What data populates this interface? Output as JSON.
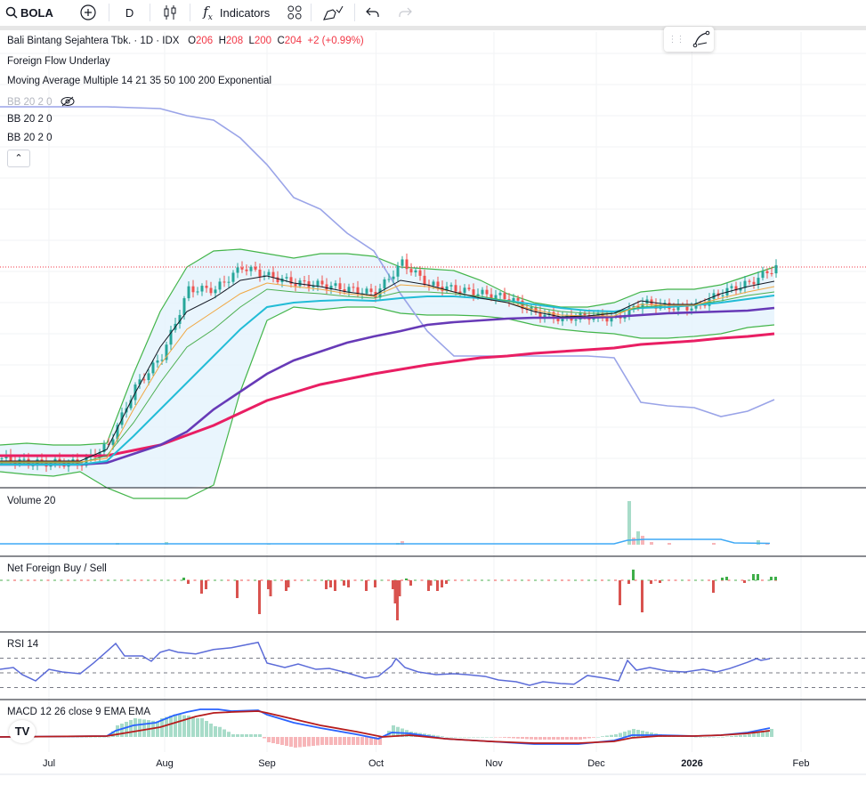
{
  "toolbar": {
    "symbol": "BOLA",
    "interval": "D",
    "indicators_label": "Indicators"
  },
  "legend": {
    "title": "Bali Bintang Sejahtera Tbk. · 1D · IDX",
    "o_label": "O",
    "o": "206",
    "h_label": "H",
    "h": "208",
    "l_label": "L",
    "l": "200",
    "c_label": "C",
    "c": "204",
    "change": "+2 (+0.99%)",
    "indicators": [
      "Foreign Flow Underlay",
      "Moving Average Multiple 14 21 35 50 100 200 Exponential",
      "BB 20 2 0",
      "BB 20 2 0",
      "BB 20 2 0"
    ]
  },
  "colors": {
    "up": "#26a69a",
    "down": "#ef5350",
    "ma14": "#131722",
    "ma21": "#f0a742",
    "ma35": "#4caf50",
    "ma50": "#22bcd6",
    "ma100": "#673ab7",
    "ma200": "#e91e63",
    "bb": "#43b54a",
    "bb_fill": "#e3f2fd",
    "flow": "#9aa4e8",
    "rsi": "#5b6bd8",
    "macd": "#2962ff",
    "signal": "#b71c1c"
  },
  "chart_data": {
    "type": "line",
    "title": "BOLA 1D IDX",
    "x_unit": "bar index",
    "xlim": [
      0,
      194
    ],
    "price_ylim": [
      80,
      339
    ],
    "last_price": 204,
    "x_axis_labels": [
      {
        "label": "Jul",
        "bar": 11
      },
      {
        "label": "Aug",
        "bar": 37
      },
      {
        "label": "Sep",
        "bar": 60
      },
      {
        "label": "Oct",
        "bar": 84.5
      },
      {
        "label": "Nov",
        "bar": 111
      },
      {
        "label": "Dec",
        "bar": 134
      },
      {
        "label": "2026",
        "bar": 155.5
      },
      {
        "label": "Feb",
        "bar": 180
      }
    ],
    "sample_step": 6,
    "close": [
      96.5,
      94,
      94,
      94,
      104,
      136.5,
      154,
      191.5,
      191.5,
      204,
      199,
      195,
      194,
      191.5,
      189,
      206.5,
      194,
      191.5,
      189,
      186.5,
      178,
      175,
      176.5,
      175,
      184,
      181.5,
      181.5,
      190,
      195,
      204
    ],
    "ma14": [
      95,
      95,
      95,
      95,
      101.5,
      131.5,
      159,
      179,
      186.5,
      196.5,
      199,
      195,
      193,
      190,
      188,
      196.5,
      194,
      190,
      186.5,
      184,
      179,
      176,
      176.5,
      178,
      185,
      183,
      183,
      189,
      193,
      196
    ],
    "ma21": [
      94.5,
      94.5,
      94.5,
      94.5,
      96.5,
      124,
      149,
      169,
      179,
      189,
      195,
      193,
      191.5,
      189,
      187.5,
      194,
      193,
      190,
      186.5,
      184,
      180,
      177,
      176.5,
      176.5,
      183,
      182.5,
      182.5,
      186.5,
      190,
      193
    ],
    "ma35": [
      94,
      94,
      94,
      94,
      98,
      116.5,
      139,
      159,
      169,
      181.5,
      191.5,
      190,
      189,
      187.5,
      186.5,
      190,
      190,
      189,
      187.5,
      185,
      181.5,
      179,
      178,
      178,
      181.5,
      182.5,
      183,
      185,
      188,
      190
    ],
    "ma50": [
      93,
      93,
      93,
      93,
      95,
      109,
      124,
      139,
      154,
      169,
      181.5,
      184,
      185,
      185.5,
      185,
      186.5,
      187.5,
      187.5,
      186.5,
      185,
      183,
      181,
      179.5,
      179,
      181,
      181.5,
      182.5,
      184,
      186,
      188
    ],
    "ma100": [
      93,
      93,
      93,
      93,
      94,
      99,
      104,
      111.5,
      124,
      134,
      144,
      151.5,
      156.5,
      161.5,
      165,
      168,
      171.5,
      173,
      174,
      175,
      175.5,
      175.5,
      175.5,
      176,
      177,
      178,
      178.5,
      179,
      179.5,
      181
    ],
    "ma200": [
      98,
      98,
      98,
      98,
      98,
      101,
      104,
      109.5,
      115,
      122,
      129,
      133.5,
      138,
      141,
      144,
      146.5,
      149,
      151,
      153,
      154,
      155.5,
      156.5,
      157.5,
      158.5,
      160.5,
      161.5,
      162.5,
      164,
      165,
      166.5
    ],
    "bb_upper": [
      104,
      105,
      104,
      104,
      105,
      144,
      179,
      204,
      213,
      214,
      211.5,
      209,
      211.5,
      211.5,
      210,
      204,
      203,
      202,
      196.5,
      189,
      184,
      181.5,
      181.5,
      184,
      190,
      191.5,
      191.5,
      194,
      199,
      204
    ],
    "bb_lower": [
      89,
      87.5,
      86.5,
      89,
      80,
      69,
      64,
      66.5,
      81.5,
      134,
      174,
      181.5,
      180,
      181.5,
      181.5,
      178,
      177,
      177,
      176.5,
      175,
      171.5,
      169,
      167.5,
      166.5,
      164,
      164,
      165,
      166.5,
      170,
      171.5
    ],
    "foreign_flow_line": [
      294,
      294,
      294,
      294,
      294,
      293.5,
      293,
      289,
      286.5,
      276.5,
      261.5,
      243,
      236.5,
      223,
      213,
      189,
      168,
      154,
      154,
      154,
      154,
      154,
      154,
      153,
      128,
      126,
      125,
      120,
      123,
      129.5
    ],
    "volume": {
      "title": "Volume 20",
      "bars": [
        [
          26,
          2,
          true
        ],
        [
          37,
          3,
          true
        ],
        [
          60,
          1,
          true
        ],
        [
          89,
          2,
          true
        ],
        [
          90,
          4,
          false
        ],
        [
          141,
          49,
          true
        ],
        [
          142,
          8,
          false
        ],
        [
          143,
          15,
          true
        ],
        [
          144,
          10,
          false
        ],
        [
          146,
          3,
          false
        ],
        [
          150,
          2,
          false
        ],
        [
          160,
          2,
          false
        ],
        [
          170,
          5,
          true
        ],
        [
          172,
          1,
          false
        ]
      ],
      "ma": [
        [
          0,
          1
        ],
        [
          138,
          1
        ],
        [
          141,
          5
        ],
        [
          145,
          6
        ],
        [
          162,
          6
        ],
        [
          165,
          2
        ],
        [
          173,
          1.5
        ]
      ]
    },
    "net_foreign": {
      "title": "Net Foreign Buy / Sell",
      "bars": [
        [
          41,
          3
        ],
        [
          42,
          -4
        ],
        [
          45,
          -15
        ],
        [
          46,
          -10
        ],
        [
          53,
          -20
        ],
        [
          58,
          -38
        ],
        [
          60,
          -10
        ],
        [
          60.5,
          -18
        ],
        [
          64,
          -12
        ],
        [
          64.5,
          -8
        ],
        [
          73,
          -10
        ],
        [
          74,
          -8
        ],
        [
          75,
          -12
        ],
        [
          77,
          -6
        ],
        [
          78,
          -8
        ],
        [
          82,
          -12
        ],
        [
          84,
          -8
        ],
        [
          88,
          -10
        ],
        [
          88.5,
          -26
        ],
        [
          89,
          -45
        ],
        [
          89.5,
          -18
        ],
        [
          91,
          2
        ],
        [
          92,
          -6
        ],
        [
          96,
          -12
        ],
        [
          96.5,
          -6
        ],
        [
          98,
          -12
        ],
        [
          99,
          -8
        ],
        [
          100,
          -4
        ],
        [
          139,
          -28
        ],
        [
          141,
          -4
        ],
        [
          142,
          12
        ],
        [
          144,
          -36
        ],
        [
          146,
          -4
        ],
        [
          148,
          -3
        ],
        [
          160,
          -14
        ],
        [
          162,
          3
        ],
        [
          163,
          4
        ],
        [
          167,
          -3
        ],
        [
          169,
          7
        ],
        [
          170,
          7
        ],
        [
          173,
          4
        ],
        [
          174,
          4
        ]
      ]
    },
    "rsi": {
      "title": "RSI 14",
      "levels": [
        70,
        50,
        30
      ],
      "points": [
        [
          0,
          54.8
        ],
        [
          3,
          57.3
        ],
        [
          5,
          47.6
        ],
        [
          8,
          39.1
        ],
        [
          11,
          54.8
        ],
        [
          14,
          51.2
        ],
        [
          18,
          48.8
        ],
        [
          21,
          63.3
        ],
        [
          24,
          79.1
        ],
        [
          26,
          90
        ],
        [
          28,
          73
        ],
        [
          32,
          73
        ],
        [
          34,
          65.8
        ],
        [
          36,
          78
        ],
        [
          38,
          81.5
        ],
        [
          40,
          78
        ],
        [
          44,
          75.8
        ],
        [
          48,
          81.8
        ],
        [
          52,
          84.2
        ],
        [
          55,
          87.9
        ],
        [
          58,
          91.5
        ],
        [
          60,
          63.3
        ],
        [
          64,
          57.3
        ],
        [
          67,
          62.1
        ],
        [
          71,
          54.8
        ],
        [
          74,
          56
        ],
        [
          78,
          50
        ],
        [
          82,
          42.7
        ],
        [
          85,
          45.2
        ],
        [
          88,
          59.7
        ],
        [
          89,
          69.4
        ],
        [
          91,
          57.3
        ],
        [
          94,
          51.2
        ],
        [
          98,
          47.6
        ],
        [
          102,
          48.8
        ],
        [
          105,
          47.6
        ],
        [
          109,
          45.2
        ],
        [
          112,
          40.3
        ],
        [
          116,
          37.9
        ],
        [
          119,
          33
        ],
        [
          122,
          37.9
        ],
        [
          126,
          35.5
        ],
        [
          129,
          34.5
        ],
        [
          132,
          46.4
        ],
        [
          136,
          42.7
        ],
        [
          139,
          39.1
        ],
        [
          141,
          67
        ],
        [
          143,
          53.6
        ],
        [
          146,
          57.3
        ],
        [
          150,
          52.4
        ],
        [
          154,
          51.2
        ],
        [
          158,
          54.8
        ],
        [
          161,
          51.2
        ],
        [
          164,
          56
        ],
        [
          168,
          64.5
        ],
        [
          170,
          69.4
        ],
        [
          171,
          67
        ],
        [
          173,
          69.4
        ]
      ]
    },
    "macd": {
      "title": "MACD 12 26 close 9 EMA EMA",
      "macd": [
        [
          0,
          0
        ],
        [
          24,
          0.25
        ],
        [
          26,
          1.75
        ],
        [
          30,
          3.25
        ],
        [
          35,
          4
        ],
        [
          39,
          6
        ],
        [
          42,
          7
        ],
        [
          45,
          7.75
        ],
        [
          49,
          7.75
        ],
        [
          52,
          7.25
        ],
        [
          58,
          7.5
        ],
        [
          60,
          6.25
        ],
        [
          66,
          4
        ],
        [
          72,
          2.5
        ],
        [
          80,
          0.75
        ],
        [
          85,
          -0.5
        ],
        [
          88,
          1.25
        ],
        [
          92,
          1
        ],
        [
          100,
          -0.5
        ],
        [
          110,
          -1.25
        ],
        [
          120,
          -2
        ],
        [
          130,
          -2
        ],
        [
          138,
          -1
        ],
        [
          142,
          0.5
        ],
        [
          148,
          0.5
        ],
        [
          156,
          0.25
        ],
        [
          162,
          0.5
        ],
        [
          168,
          1.25
        ],
        [
          173,
          2.5
        ]
      ],
      "signal": [
        [
          0,
          0
        ],
        [
          24,
          0.25
        ],
        [
          30,
          1.5
        ],
        [
          36,
          2.75
        ],
        [
          40,
          4.25
        ],
        [
          44,
          5.75
        ],
        [
          48,
          6.75
        ],
        [
          52,
          7
        ],
        [
          58,
          7.25
        ],
        [
          60,
          6.75
        ],
        [
          66,
          5
        ],
        [
          72,
          3.25
        ],
        [
          80,
          1.5
        ],
        [
          86,
          0
        ],
        [
          92,
          0.5
        ],
        [
          100,
          -0.5
        ],
        [
          110,
          -1.25
        ],
        [
          120,
          -1.75
        ],
        [
          130,
          -1.75
        ],
        [
          138,
          -1.25
        ],
        [
          142,
          -0.25
        ],
        [
          148,
          0.25
        ],
        [
          156,
          0.25
        ],
        [
          162,
          0.5
        ],
        [
          168,
          1
        ],
        [
          173,
          1.75
        ]
      ]
    }
  },
  "logo": "TV"
}
